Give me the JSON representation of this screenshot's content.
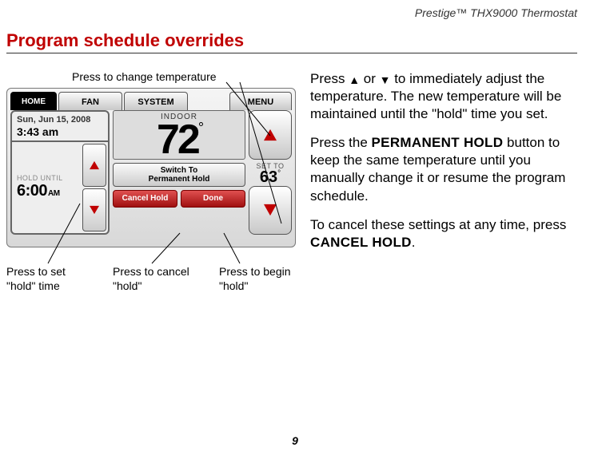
{
  "header": {
    "product": "Prestige™ THX9000 Thermostat"
  },
  "title": "Program schedule overrides",
  "callouts": {
    "top": "Press to change temperature",
    "bottom": [
      "Press to set \"hold\" time",
      "Press to cancel \"hold\"",
      "Press to begin \"hold\""
    ]
  },
  "body": {
    "p1a": "Press ",
    "p1b": " or ",
    "p1c": " to immediately adjust the temperature. The new temperature will be maintained until the \"hold\" time you set.",
    "p2a": "Press the ",
    "p2b": " button to keep the same temperature until you manually change it or resume the program schedule.",
    "p3a": "To cancel these settings at any time, press ",
    "p3b": ".",
    "keycap_perm": "PERMANENT HOLD",
    "keycap_cancel": "CANCEL HOLD"
  },
  "thermo": {
    "tabs": {
      "home": "HOME",
      "fan": "FAN",
      "system": "SYSTEM",
      "menu": "MENU"
    },
    "date": "Sun, Jun 15, 2008",
    "time": "3:43 am",
    "hold_until_label": "HOLD UNTIL",
    "hold_time": "6:00",
    "hold_ampm": "AM",
    "indoor_label": "INDOOR",
    "indoor_temp": "72",
    "switch_line1": "Switch To",
    "switch_line2": "Permanent Hold",
    "cancel_hold": "Cancel Hold",
    "done": "Done",
    "set_to_label": "SET TO",
    "set_to_temp": "63"
  },
  "page": "9"
}
